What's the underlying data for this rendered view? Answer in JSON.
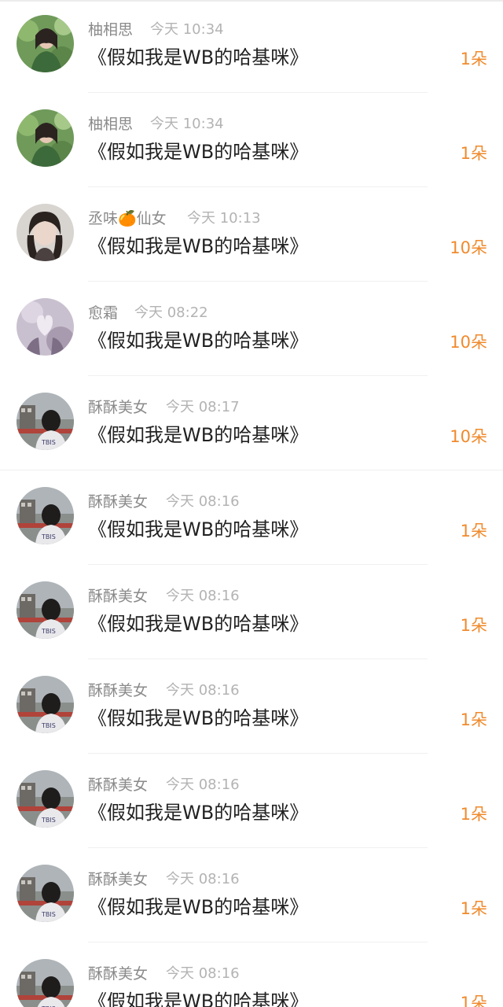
{
  "items": [
    {
      "name": "柚相思",
      "time": "今天 10:34",
      "title": "《假如我是WB的哈基咪》",
      "gift": "1朵",
      "avatar": "avatar-girl-flowers"
    },
    {
      "name": "柚相思",
      "time": "今天 10:34",
      "title": "《假如我是WB的哈基咪》",
      "gift": "1朵",
      "avatar": "avatar-girl-flowers"
    },
    {
      "name": "丞味🍊仙女",
      "time": "今天 10:13",
      "title": "《假如我是WB的哈基咪》",
      "gift": "10朵",
      "avatar": "avatar-girl-portrait"
    },
    {
      "name": "愈霜",
      "time": "今天 08:22",
      "title": "《假如我是WB的哈基咪》",
      "gift": "10朵",
      "avatar": "avatar-heart-hands"
    },
    {
      "name": "酥酥美女",
      "time": "今天 08:17",
      "title": "《假如我是WB的哈基咪》",
      "gift": "10朵",
      "avatar": "avatar-girl-back"
    },
    {
      "name": "酥酥美女",
      "time": "今天 08:16",
      "title": "《假如我是WB的哈基咪》",
      "gift": "1朵",
      "avatar": "avatar-girl-back"
    },
    {
      "name": "酥酥美女",
      "time": "今天 08:16",
      "title": "《假如我是WB的哈基咪》",
      "gift": "1朵",
      "avatar": "avatar-girl-back"
    },
    {
      "name": "酥酥美女",
      "time": "今天 08:16",
      "title": "《假如我是WB的哈基咪》",
      "gift": "1朵",
      "avatar": "avatar-girl-back"
    },
    {
      "name": "酥酥美女",
      "time": "今天 08:16",
      "title": "《假如我是WB的哈基咪》",
      "gift": "1朵",
      "avatar": "avatar-girl-back"
    },
    {
      "name": "酥酥美女",
      "time": "今天 08:16",
      "title": "《假如我是WB的哈基咪》",
      "gift": "1朵",
      "avatar": "avatar-girl-back"
    },
    {
      "name": "酥酥美女",
      "time": "今天 08:16",
      "title": "《假如我是WB的哈基咪》",
      "gift": "1朵",
      "avatar": "avatar-girl-back"
    }
  ],
  "colors": {
    "gift": "#f08a2c",
    "name": "#8a8a8a",
    "time": "#b3b3b3",
    "title": "#222222"
  }
}
